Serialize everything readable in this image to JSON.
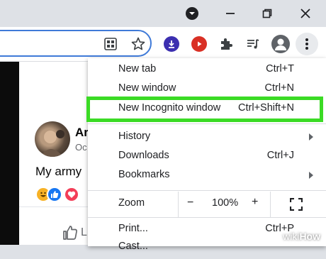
{
  "titlebar": {
    "dropdown_icon": "chevron-down-icon",
    "minimize_icon": "minimize-icon",
    "restore_icon": "restore-icon",
    "close_icon": "close-icon"
  },
  "toolbar": {
    "icons": [
      "grid-icon",
      "star-icon",
      "download-icon",
      "record-icon",
      "puzzle-icon",
      "media-icon",
      "profile-icon",
      "more-vert-icon"
    ]
  },
  "page": {
    "author": "Ar",
    "date": "Oc",
    "post_text": "My army",
    "like_text": "L",
    "reactions": [
      "laugh-icon",
      "like-icon",
      "love-icon"
    ]
  },
  "menu": {
    "items": [
      {
        "label": "New tab",
        "shortcut": "Ctrl+T"
      },
      {
        "label": "New window",
        "shortcut": "Ctrl+N"
      },
      {
        "label": "New Incognito window",
        "shortcut": "Ctrl+Shift+N"
      },
      {
        "label": "History",
        "shortcut": ""
      },
      {
        "label": "Downloads",
        "shortcut": "Ctrl+J"
      },
      {
        "label": "Bookmarks",
        "shortcut": ""
      },
      {
        "label": "Print...",
        "shortcut": "Ctrl+P"
      },
      {
        "label": "Cast...",
        "shortcut": ""
      }
    ],
    "zoom": {
      "label": "Zoom",
      "minus": "−",
      "value": "100%",
      "plus": "+"
    }
  },
  "watermark": {
    "prefix": "wiki",
    "suffix": "How"
  },
  "colors": {
    "highlight": "#3bdb25",
    "omnibox_border": "#3f7ad8",
    "download_badge": "#3c2fb0",
    "record_badge": "#d93025"
  }
}
